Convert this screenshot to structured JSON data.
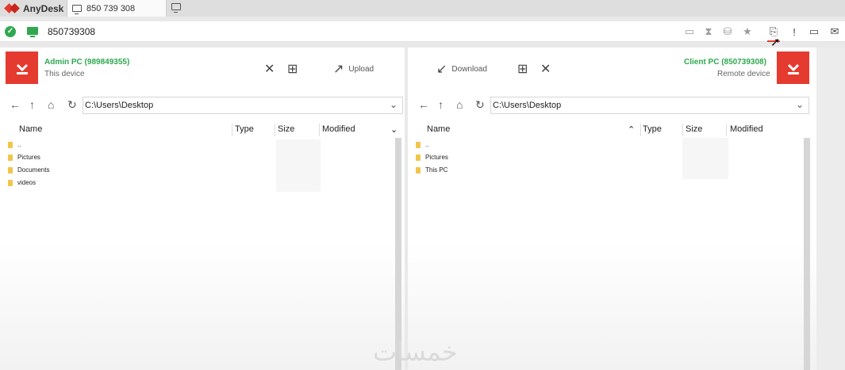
{
  "titlebar": {
    "app_name": "AnyDesk",
    "tab_address": "850 739 308"
  },
  "addressbar": {
    "address": "850739308"
  },
  "left_panel": {
    "pc_name": "Admin PC (989849355)",
    "pc_sub": "This device",
    "upload_label": "Upload",
    "path": "C:\\Users\\Desktop",
    "columns": [
      "Name",
      "Type",
      "Size",
      "Modified"
    ],
    "files": [
      "..",
      "Pictures",
      "Documents",
      "videos"
    ]
  },
  "right_panel": {
    "pc_name": "Client  PC (850739308)",
    "pc_sub": "Remote device",
    "download_label": "Download",
    "path": "C:\\Users\\Desktop",
    "columns": [
      "Name",
      "Type",
      "Size",
      "Modified"
    ],
    "files": [
      "..",
      "Pictures",
      "This PC"
    ]
  },
  "watermark": "خمسات",
  "colors": {
    "accent": "#e53a2f",
    "green": "#2fa84f"
  }
}
